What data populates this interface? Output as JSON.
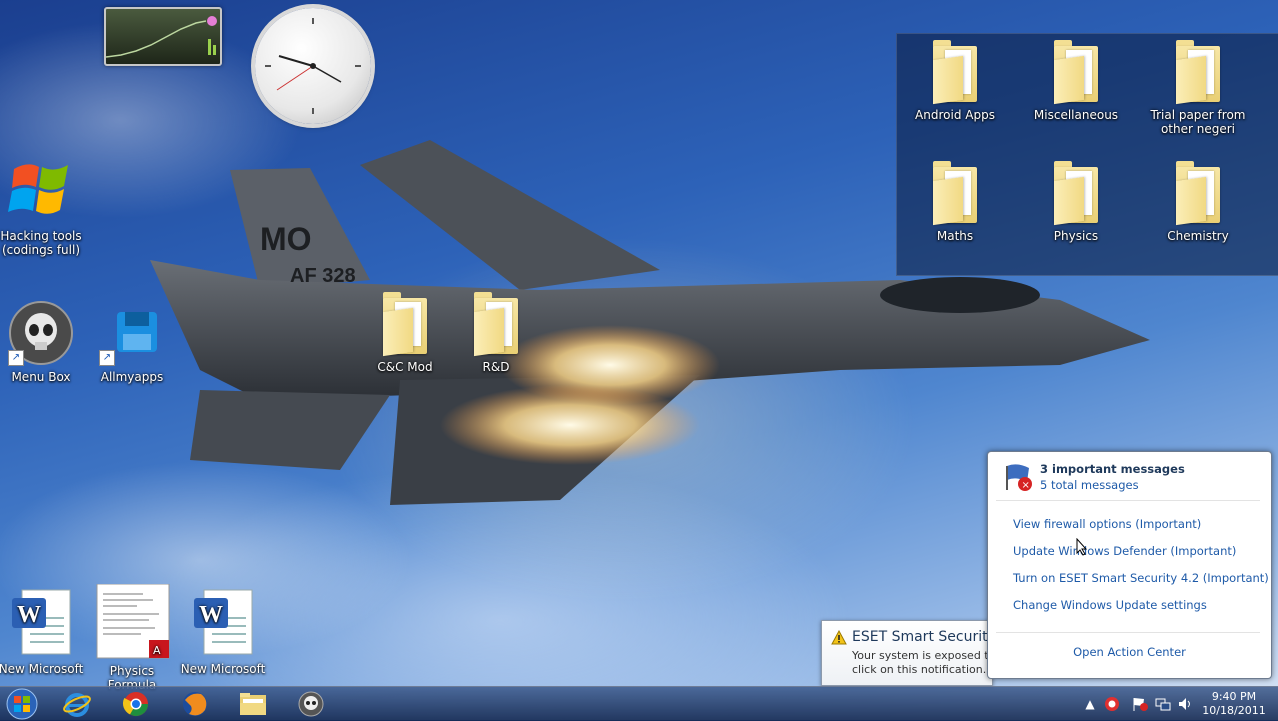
{
  "desktop": {
    "icons": [
      {
        "id": "hacking",
        "label": "Hacking tools (codings full)"
      },
      {
        "id": "menubox",
        "label": "Menu Box"
      },
      {
        "id": "allmyapps",
        "label": "Allmyapps"
      },
      {
        "id": "cc",
        "label": "C&C Mod"
      },
      {
        "id": "rd",
        "label": "R&D"
      },
      {
        "id": "word1",
        "label": "New Microsoft"
      },
      {
        "id": "physics",
        "label": "Physics Formula"
      },
      {
        "id": "word2",
        "label": "New Microsoft"
      }
    ],
    "jet_markings": {
      "tail_code": "MO",
      "serial": "AF 328"
    }
  },
  "fence": {
    "items": [
      {
        "label": "Android Apps"
      },
      {
        "label": "Miscellaneous"
      },
      {
        "label": "Trial paper from other negeri"
      },
      {
        "label": "Maths"
      },
      {
        "label": "Physics"
      },
      {
        "label": "Chemistry"
      }
    ]
  },
  "action_center": {
    "title": "3 important messages",
    "subtitle": "5 total messages",
    "links": [
      "View firewall options (Important)",
      "Update Windows Defender (Important)",
      "Turn on ESET Smart Security 4.2 (Important)",
      "Change Windows Update settings"
    ],
    "open": "Open Action Center"
  },
  "toast": {
    "title": "ESET Smart Security",
    "line1": "Your system is exposed to r",
    "line2": "click on this notification."
  },
  "taskbar": {
    "pinned": [
      "internet-explorer",
      "chrome",
      "firefox",
      "windows-explorer",
      "menu-box"
    ],
    "time": "9:40 PM",
    "date": "10/18/2011"
  },
  "colors": {
    "link": "#1e5aa8",
    "taskbar": "#1e3a6e"
  }
}
